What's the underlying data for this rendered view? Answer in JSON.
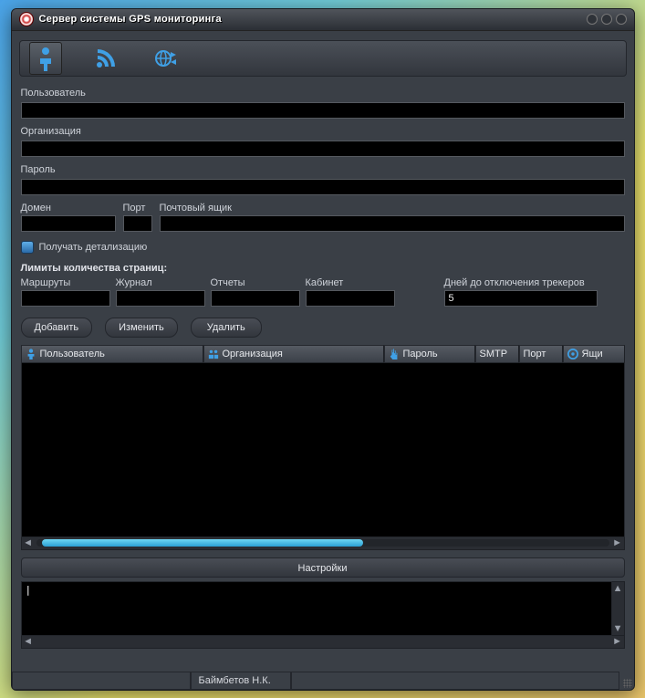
{
  "window": {
    "title": "Сервер системы GPS мониторинга"
  },
  "toolbar": {
    "items": [
      "user",
      "rss",
      "globe"
    ]
  },
  "form": {
    "user_label": "Пользователь",
    "org_label": "Организация",
    "password_label": "Пароль",
    "domain_label": "Домен",
    "port_label": "Порт",
    "mailbox_label": "Почтовый ящик",
    "user_value": "",
    "org_value": "",
    "password_value": "",
    "domain_value": "",
    "port_value": "",
    "mailbox_value": ""
  },
  "checkbox": {
    "label": "Получать детализацию",
    "checked": false
  },
  "limits": {
    "heading": "Лимиты количества страниц:",
    "routes_label": "Маршруты",
    "journal_label": "Журнал",
    "reports_label": "Отчеты",
    "cabinet_label": "Кабинет",
    "days_label": "Дней до отключения трекеров",
    "routes_value": "",
    "journal_value": "",
    "reports_value": "",
    "cabinet_value": "",
    "days_value": "5"
  },
  "buttons": {
    "add": "Добавить",
    "edit": "Изменить",
    "delete": "Удалить"
  },
  "table": {
    "columns": {
      "user": "Пользователь",
      "org": "Организация",
      "password": "Пароль",
      "smtp": "SMTP",
      "port": "Порт",
      "mailbox": "Ящи"
    },
    "rows": []
  },
  "settings_button": "Настройки",
  "log": {
    "text": "|"
  },
  "status": {
    "author": "Баймбетов Н.К."
  }
}
